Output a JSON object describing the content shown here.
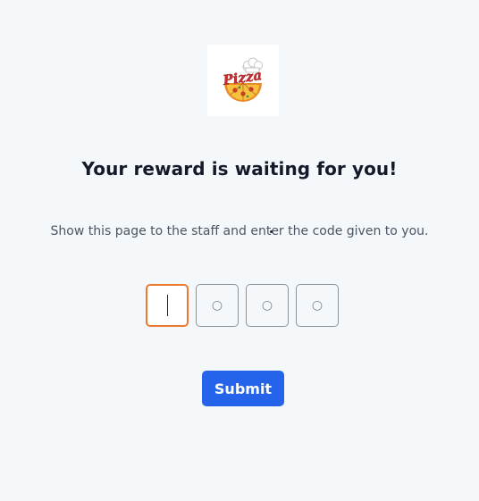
{
  "brand": {
    "logo_text": "Pizza",
    "logo_icon": "pizza-logo"
  },
  "title": "Your reward is waiting for you!",
  "subtitle": "Show this page to the staff and enter the code given to you.",
  "code_inputs": [
    {
      "placeholder": "",
      "value": "",
      "active": true
    },
    {
      "placeholder": "○",
      "value": "",
      "active": false
    },
    {
      "placeholder": "○",
      "value": "",
      "active": false
    },
    {
      "placeholder": "○",
      "value": "",
      "active": false
    }
  ],
  "submit_label": "Submit",
  "colors": {
    "background": "#f5f8fb",
    "accent": "#2563eb",
    "active_border": "#ea7a2e",
    "text": "#141a29"
  }
}
